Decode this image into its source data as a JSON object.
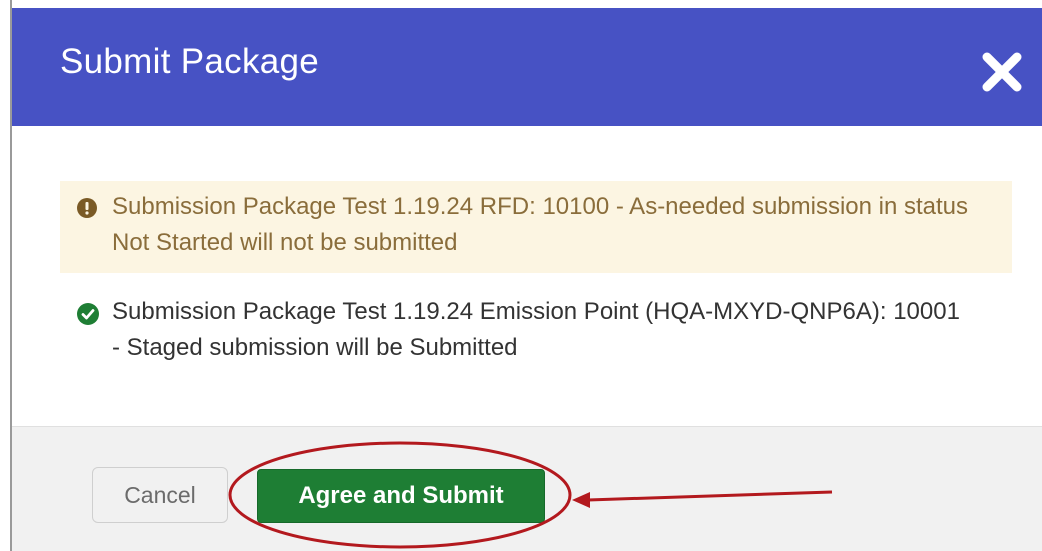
{
  "dialog": {
    "title": "Submit Package",
    "close_icon": "close-icon"
  },
  "messages": [
    {
      "type": "warning",
      "icon": "exclamation-circle-icon",
      "text": "Submission Package Test 1.19.24 RFD: 10100 - As-needed submission in status Not Started will not be submitted"
    },
    {
      "type": "success",
      "icon": "check-circle-icon",
      "text": "Submission Package Test 1.19.24 Emission Point (HQA-MXYD-QNP6A): 10001 - Staged submission will be Submitted"
    }
  ],
  "footer": {
    "cancel_label": "Cancel",
    "submit_label": "Agree and Submit"
  },
  "colors": {
    "header": "#4752c4",
    "warning_bg": "#fcf5e2",
    "warning_text": "#8a6d3b",
    "success_icon": "#1e7e34",
    "submit_button": "#1e7e34",
    "annotation": "#b3191e"
  }
}
